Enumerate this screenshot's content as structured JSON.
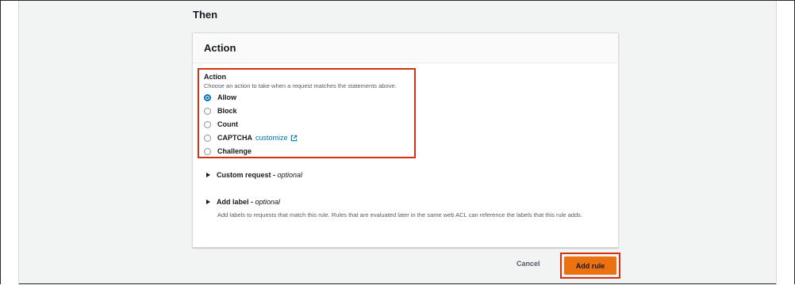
{
  "section": {
    "title": "Then"
  },
  "panel": {
    "header": "Action"
  },
  "action_field": {
    "label": "Action",
    "description": "Choose an action to take when a request matches the statements above.",
    "options": [
      {
        "label": "Allow",
        "checked": true
      },
      {
        "label": "Block",
        "checked": false
      },
      {
        "label": "Count",
        "checked": false
      },
      {
        "label": "CAPTCHA",
        "checked": false,
        "link": "customize"
      },
      {
        "label": "Challenge",
        "checked": false
      }
    ]
  },
  "custom_request": {
    "label": "Custom request",
    "optional": "optional"
  },
  "add_label": {
    "label": "Add label",
    "optional": "optional",
    "description": "Add labels to requests that match this rule. Rules that are evaluated later in the same web ACL can reference the labels that this rule adds."
  },
  "footer": {
    "cancel": "Cancel",
    "add_rule": "Add rule"
  },
  "colors": {
    "accent": "#0073bb",
    "primary_button": "#ec7211",
    "highlight": "#d13212"
  }
}
